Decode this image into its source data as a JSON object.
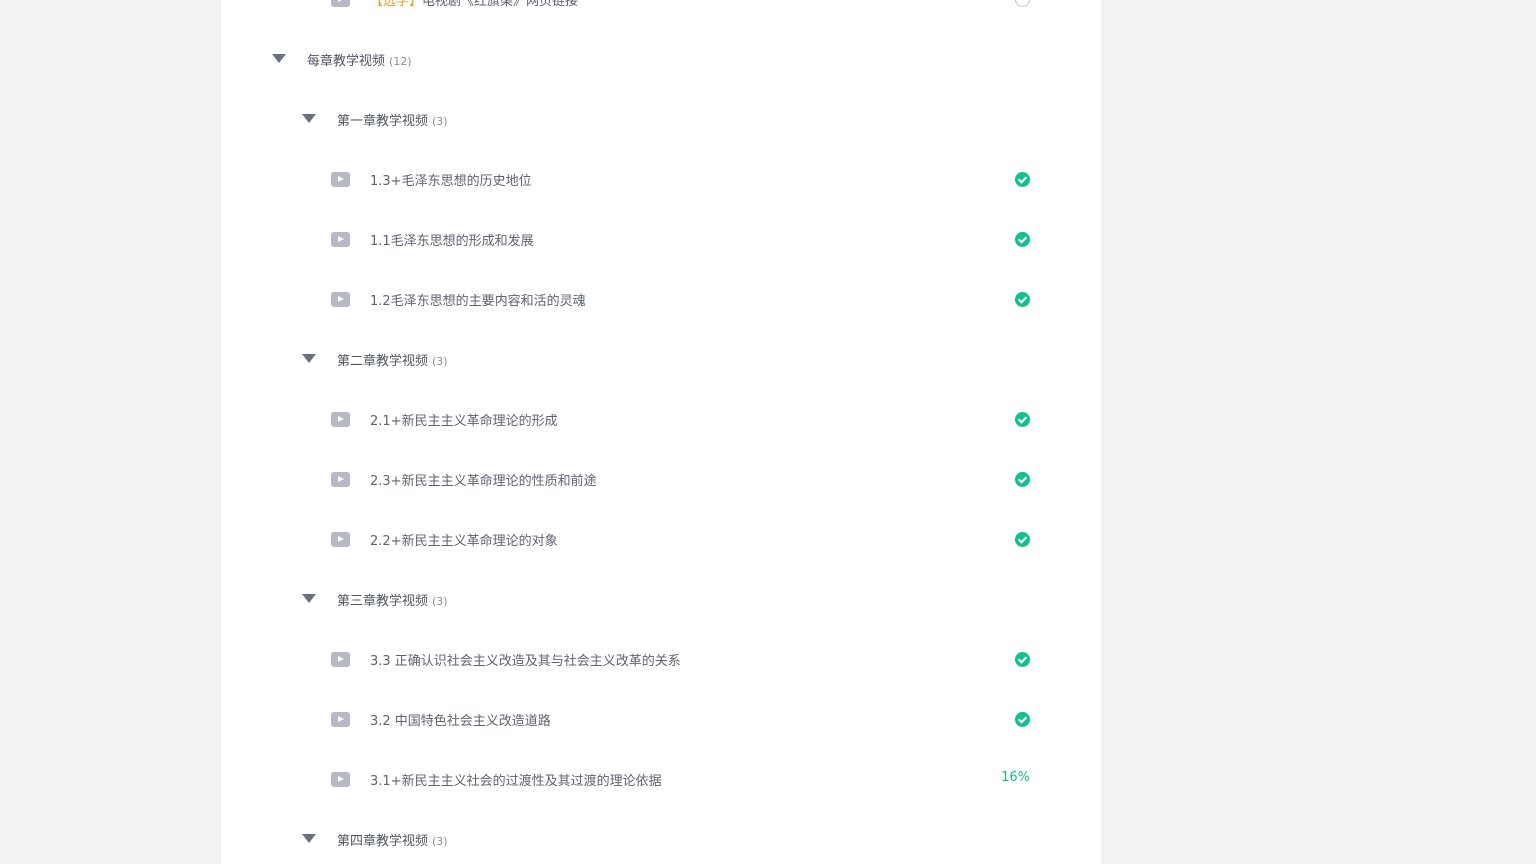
{
  "top_partial": {
    "tag": "【选学】",
    "label": "电视剧《红旗渠》网页链接"
  },
  "root_folder": {
    "label": "每章教学视频",
    "count": "(12)"
  },
  "chapters": [
    {
      "label": "第一章教学视频",
      "count": "(3)",
      "items": [
        {
          "label": "1.3+毛泽东思想的历史地位",
          "status": "done"
        },
        {
          "label": "1.1毛泽东思想的形成和发展",
          "status": "done"
        },
        {
          "label": "1.2毛泽东思想的主要内容和活的灵魂",
          "status": "done"
        }
      ]
    },
    {
      "label": "第二章教学视频",
      "count": "(3)",
      "items": [
        {
          "label": "2.1+新民主主义革命理论的形成",
          "status": "done"
        },
        {
          "label": "2.3+新民主主义革命理论的性质和前途",
          "status": "done"
        },
        {
          "label": "2.2+新民主主义革命理论的对象",
          "status": "done"
        }
      ]
    },
    {
      "label": "第三章教学视频",
      "count": "(3)",
      "items": [
        {
          "label": "3.3 正确认识社会主义改造及其与社会主义改革的关系",
          "status": "done"
        },
        {
          "label": "3.2 中国特色社会主义改造道路",
          "status": "done"
        },
        {
          "label": "3.1+新民主主义社会的过渡性及其过渡的理论依据",
          "status": "progress",
          "progress": "16%"
        }
      ]
    },
    {
      "label": "第四章教学视频",
      "count": "(3)",
      "items": []
    }
  ],
  "colors": {
    "page_bg": "#f1f2f4",
    "panel_bg": "#ffffff",
    "accent_green": "#14c08e",
    "tag_orange": "#f0a030"
  },
  "icons": {
    "folder_toggle": "triangle-down-icon",
    "video": "video-play-icon",
    "completed": "check-circle-icon",
    "not_started": "empty-circle-icon"
  }
}
